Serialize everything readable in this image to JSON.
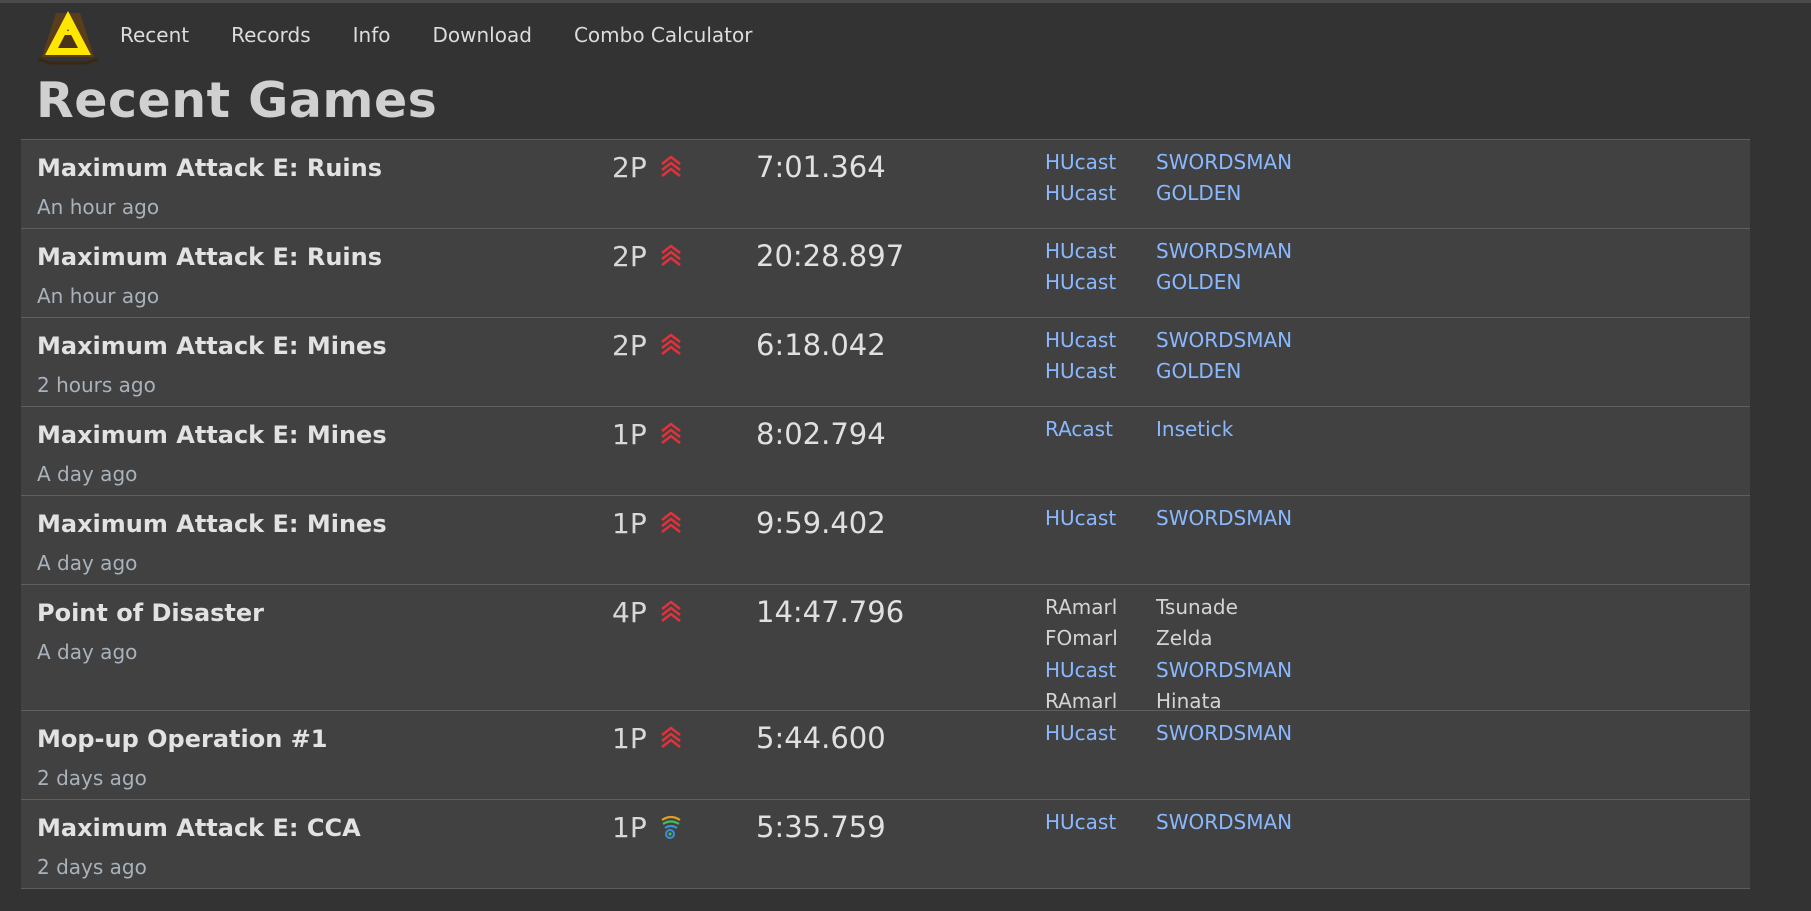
{
  "nav": {
    "logo_icon": "triangle-logo-icon",
    "links": [
      "Recent",
      "Records",
      "Info",
      "Download",
      "Combo Calculator"
    ]
  },
  "page_title": "Recent Games",
  "colors": {
    "background": "#333333",
    "row_background": "#414141",
    "link_blue": "#8ab8ff",
    "mode_red": "#e0323c",
    "logo_yellow": "#ffe600"
  },
  "games": [
    {
      "quest": "Maximum Attack E: Ruins",
      "time_ago": "An hour ago",
      "players": "2P",
      "mode_icon": "ultimate-chevron-icon",
      "time": "7:01.364",
      "party": [
        {
          "class": "HUcast",
          "name": "SWORDSMAN",
          "link": true
        },
        {
          "class": "HUcast",
          "name": "GOLDEN",
          "link": true
        }
      ]
    },
    {
      "quest": "Maximum Attack E: Ruins",
      "time_ago": "An hour ago",
      "players": "2P",
      "mode_icon": "ultimate-chevron-icon",
      "time": "20:28.897",
      "party": [
        {
          "class": "HUcast",
          "name": "SWORDSMAN",
          "link": true
        },
        {
          "class": "HUcast",
          "name": "GOLDEN",
          "link": true
        }
      ]
    },
    {
      "quest": "Maximum Attack E: Mines",
      "time_ago": "2 hours ago",
      "players": "2P",
      "mode_icon": "ultimate-chevron-icon",
      "time": "6:18.042",
      "party": [
        {
          "class": "HUcast",
          "name": "SWORDSMAN",
          "link": true
        },
        {
          "class": "HUcast",
          "name": "GOLDEN",
          "link": true
        }
      ]
    },
    {
      "quest": "Maximum Attack E: Mines",
      "time_ago": "A day ago",
      "players": "1P",
      "mode_icon": "ultimate-chevron-icon",
      "time": "8:02.794",
      "party": [
        {
          "class": "RAcast",
          "name": "Insetick",
          "link": true
        }
      ]
    },
    {
      "quest": "Maximum Attack E: Mines",
      "time_ago": "A day ago",
      "players": "1P",
      "mode_icon": "ultimate-chevron-icon",
      "time": "9:59.402",
      "party": [
        {
          "class": "HUcast",
          "name": "SWORDSMAN",
          "link": true
        }
      ]
    },
    {
      "quest": "Point of Disaster",
      "time_ago": "A day ago",
      "players": "4P",
      "mode_icon": "ultimate-chevron-icon",
      "time": "14:47.796",
      "party": [
        {
          "class": "RAmarl",
          "name": "Tsunade",
          "link": false
        },
        {
          "class": "FOmarl",
          "name": "Zelda",
          "link": false
        },
        {
          "class": "HUcast",
          "name": "SWORDSMAN",
          "link": true
        },
        {
          "class": "RAmarl",
          "name": "Hinata",
          "link": false
        }
      ]
    },
    {
      "quest": "Mop-up Operation #1",
      "time_ago": "2 days ago",
      "players": "1P",
      "mode_icon": "ultimate-chevron-icon",
      "time": "5:44.600",
      "party": [
        {
          "class": "HUcast",
          "name": "SWORDSMAN",
          "link": true
        }
      ]
    },
    {
      "quest": "Maximum Attack E: CCA",
      "time_ago": "2 days ago",
      "players": "1P",
      "mode_icon": "rainbow-section-icon",
      "time": "5:35.759",
      "party": [
        {
          "class": "HUcast",
          "name": "SWORDSMAN",
          "link": true
        }
      ]
    }
  ]
}
